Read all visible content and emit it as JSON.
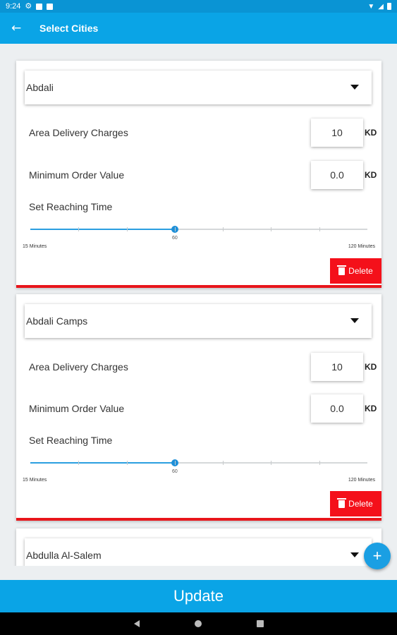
{
  "status_bar": {
    "time": "9:24"
  },
  "app_bar": {
    "title": "Select Cities",
    "back_icon": "arrow-back-icon"
  },
  "cities": [
    {
      "name": "Abdali",
      "delivery_label": "Area Delivery Charges",
      "delivery_value": "10",
      "min_order_label": "Minimum Order Value",
      "min_order_value": "0.0",
      "currency": "KD",
      "reaching_label": "Set Reaching Time",
      "slider_value": "60",
      "slider_min_label": "15 Minutes",
      "slider_max_label": "120 Minutes",
      "delete_label": "Delete"
    },
    {
      "name": "Abdali Camps",
      "delivery_label": "Area Delivery Charges",
      "delivery_value": "10",
      "min_order_label": "Minimum Order Value",
      "min_order_value": "0.0",
      "currency": "KD",
      "reaching_label": "Set Reaching Time",
      "slider_value": "60",
      "slider_min_label": "15 Minutes",
      "slider_max_label": "120 Minutes",
      "delete_label": "Delete"
    },
    {
      "name": "Abdulla Al-Salem"
    }
  ],
  "slider": {
    "min": 15,
    "max": 120,
    "value": 60,
    "step": 15
  },
  "fab": {
    "label": "+"
  },
  "update_button": {
    "label": "Update"
  },
  "colors": {
    "primary": "#0aa4e6",
    "delete": "#f4101a",
    "slider": "#1e8fd8"
  }
}
